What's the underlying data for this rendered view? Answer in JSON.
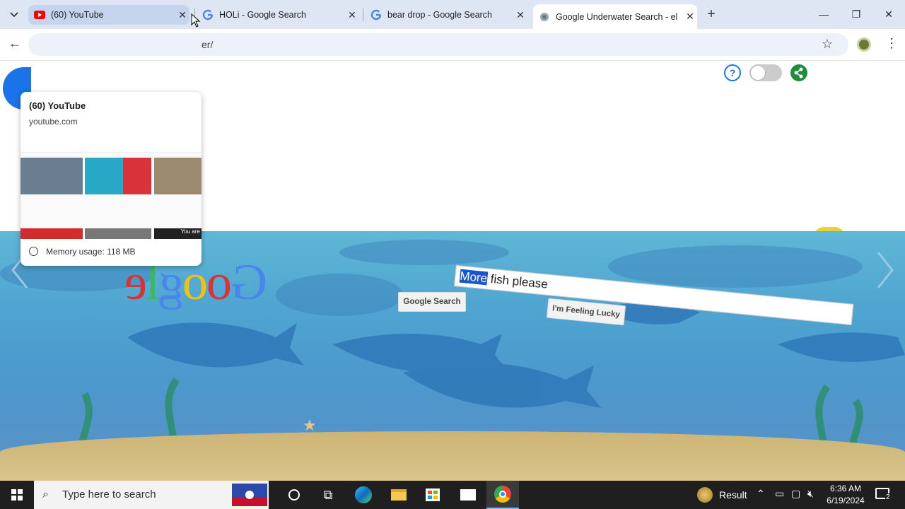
{
  "tabs": [
    {
      "title": "(60) YouTube",
      "icon": "youtube-icon"
    },
    {
      "title": "HOLi - Google Search",
      "icon": "google-icon"
    },
    {
      "title": "bear drop - Google Search",
      "icon": "google-icon"
    },
    {
      "title": "Google Underwater Search - el",
      "icon": "underwater-icon"
    }
  ],
  "omnibox_text": "er/",
  "hovercard": {
    "title": "(60) YouTube",
    "domain": "youtube.com",
    "memory": "Memory usage: 118 MB",
    "thumb_caption": "You are"
  },
  "page": {
    "logo_letters": [
      "e",
      "l",
      "g",
      "o",
      "o",
      "G"
    ],
    "search_value_selected": "More",
    "search_value_rest": " fish please",
    "search_button": "Google Search",
    "lucky_button": "I'm Feeling Lucky"
  },
  "taskbar": {
    "search_placeholder": "Type here to search",
    "weather_text": "Result",
    "time": "6:36 AM",
    "date": "6/19/2024",
    "notif_count": "2"
  },
  "colors": {
    "accent": "#1a73e8",
    "tabbar": "#dfe6f3",
    "taskbar": "#1f1f1f"
  }
}
